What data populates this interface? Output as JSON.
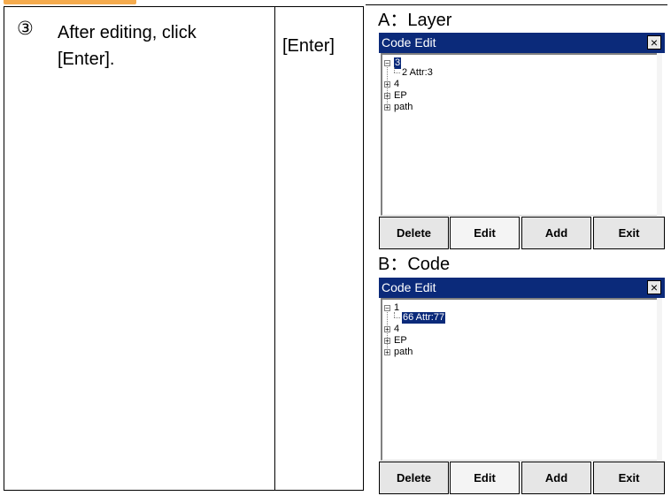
{
  "step": {
    "number": "③",
    "instruction": "After editing, click [Enter].",
    "key": "[Enter]"
  },
  "panels": [
    {
      "label": "A：Layer",
      "window": {
        "title": "Code Edit",
        "close": "×",
        "tree": {
          "root": "3",
          "child": "2  Attr:3",
          "siblings": [
            "4",
            "EP",
            "path"
          ]
        },
        "buttons": [
          "Delete",
          "Edit",
          "Add",
          "Exit"
        ]
      }
    },
    {
      "label": "B：Code",
      "window": {
        "title": "Code Edit",
        "close": "×",
        "tree": {
          "root": "1",
          "child": "66  Attr:77",
          "siblings": [
            "4",
            "EP",
            "path"
          ]
        },
        "buttons": [
          "Delete",
          "Edit",
          "Add",
          "Exit"
        ]
      }
    }
  ],
  "tree_glyphs": {
    "expanded": "−",
    "collapsed": "+"
  }
}
